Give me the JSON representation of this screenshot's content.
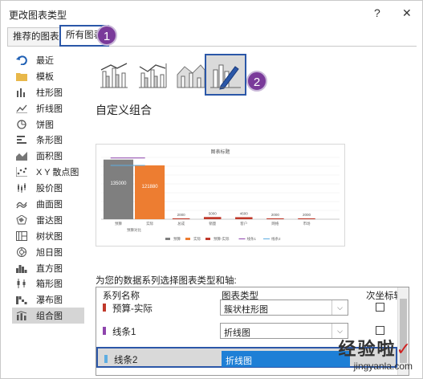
{
  "window": {
    "title": "更改图表类型",
    "help_label": "?",
    "close_label": "✕"
  },
  "tabs": [
    {
      "label": "推荐的图表",
      "active": false
    },
    {
      "label": "所有图表",
      "active": true
    }
  ],
  "annotations": {
    "badge1": "1",
    "badge2": "2"
  },
  "sidebar": {
    "items": [
      {
        "label": "最近",
        "icon": "undo-icon"
      },
      {
        "label": "模板",
        "icon": "folder-icon"
      },
      {
        "label": "柱形图",
        "icon": "column-chart-icon"
      },
      {
        "label": "折线图",
        "icon": "line-chart-icon"
      },
      {
        "label": "饼图",
        "icon": "pie-chart-icon"
      },
      {
        "label": "条形图",
        "icon": "bar-chart-icon"
      },
      {
        "label": "面积图",
        "icon": "area-chart-icon"
      },
      {
        "label": "X Y 散点图",
        "icon": "scatter-chart-icon"
      },
      {
        "label": "股价图",
        "icon": "stock-chart-icon"
      },
      {
        "label": "曲面图",
        "icon": "surface-chart-icon"
      },
      {
        "label": "雷达图",
        "icon": "radar-chart-icon"
      },
      {
        "label": "树状图",
        "icon": "treemap-icon"
      },
      {
        "label": "旭日图",
        "icon": "sunburst-icon"
      },
      {
        "label": "直方图",
        "icon": "histogram-icon"
      },
      {
        "label": "箱形图",
        "icon": "boxwhisker-icon"
      },
      {
        "label": "瀑布图",
        "icon": "waterfall-icon"
      },
      {
        "label": "组合图",
        "icon": "combo-chart-icon"
      }
    ],
    "selected_index": 16
  },
  "subtypes": [
    {
      "name": "clustered-column-line",
      "active": false
    },
    {
      "name": "clustered-column-line-secondary",
      "active": false
    },
    {
      "name": "stacked-area-clustered-column",
      "active": false
    },
    {
      "name": "custom-combination",
      "active": true
    }
  ],
  "section_title": "自定义组合",
  "preview": {
    "chart_data": {
      "type": "bar",
      "title": "图表标题",
      "categories": [
        "预算",
        "实际",
        "总成",
        "销量",
        "客户",
        "网络",
        "市场"
      ],
      "group_labels": [
        "预算对比"
      ],
      "ylim": [
        0,
        140000
      ],
      "series": [
        {
          "name": "预算",
          "color": "#7f7f7f",
          "values": [
            135000,
            null,
            null,
            null,
            null,
            null,
            null
          ]
        },
        {
          "name": "实际",
          "color": "#ed7d31",
          "values": [
            null,
            121880,
            null,
            null,
            null,
            null,
            null
          ]
        },
        {
          "name": "预算-实际",
          "color": "#c0392b",
          "values": [
            null,
            null,
            2000,
            5000,
            4600,
            2000,
            2000
          ]
        },
        {
          "name": "线条1",
          "color": "#8e44ad",
          "values": [
            135000,
            135000,
            null,
            null,
            null,
            null,
            null
          ]
        },
        {
          "name": "线条2",
          "color": "#5dade2",
          "values": [
            121880,
            121880,
            null,
            null,
            null,
            null,
            null
          ]
        }
      ],
      "data_labels": [
        "135000",
        "121880",
        "2000",
        "5000",
        "4600",
        "2000",
        "2000"
      ],
      "legend": "bottom",
      "grid": true
    }
  },
  "series_prompt": "为您的数据系列选择图表类型和轴:",
  "table": {
    "headers": {
      "name": "系列名称",
      "type": "图表类型",
      "secondary": "次坐标轴"
    },
    "rows": [
      {
        "name": "预算-实际",
        "color": "#c0392b",
        "type": "簇状柱形图",
        "secondary": false,
        "selected": false
      },
      {
        "name": "线条1",
        "color": "#8e44ad",
        "type": "折线图",
        "secondary": false,
        "selected": false
      },
      {
        "name": "线条2",
        "color": "#5dade2",
        "type": "折线图",
        "secondary": false,
        "selected": true
      }
    ]
  },
  "watermark": {
    "brand": "经验啦",
    "check": "✓",
    "url": "jingyanla.com"
  }
}
